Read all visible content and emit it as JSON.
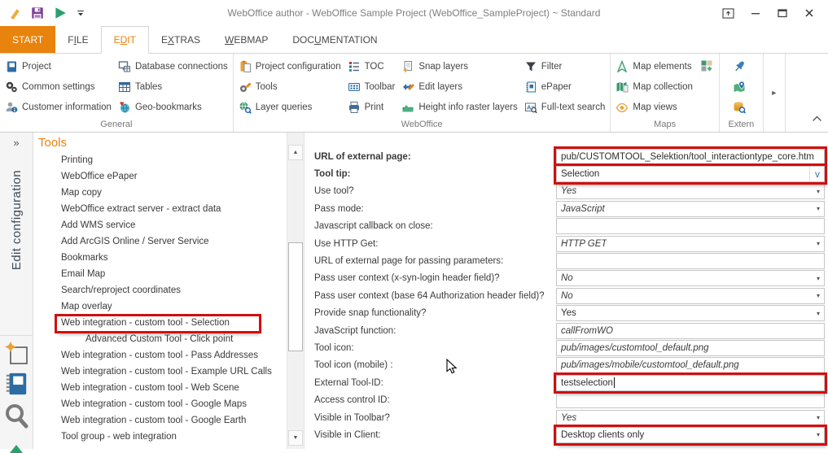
{
  "title_bar": {
    "title": "WebOffice author - WebOffice Sample Project (WebOffice_SampleProject) ~ Standard"
  },
  "glyphs": {
    "panel_collapse": "»",
    "scroll_up": "▲",
    "scroll_down": "▼",
    "dropdown_arrow": "▾",
    "combo_v": "v",
    "more_arrow": "►"
  },
  "ribbon": {
    "tabs": [
      {
        "pre": "START",
        "accel": "",
        "post": "",
        "is_start": true
      },
      {
        "pre": "F",
        "accel": "I",
        "post": "LE"
      },
      {
        "pre": "E",
        "accel": "D",
        "post": "IT",
        "is_active": true
      },
      {
        "pre": "E",
        "accel": "X",
        "post": "TRAS"
      },
      {
        "pre": "",
        "accel": "W",
        "post": "EBMAP"
      },
      {
        "pre": "DOC",
        "accel": "U",
        "post": "MENTATION"
      }
    ],
    "groups": {
      "general": {
        "label": "General",
        "buttons": [
          {
            "label": "Project",
            "icon": "project-icon"
          },
          {
            "label": "Common settings",
            "icon": "common-settings-icon"
          },
          {
            "label": "Customer information",
            "icon": "customer-information-icon"
          },
          {
            "label": "Database connections",
            "icon": "database-connections-icon"
          },
          {
            "label": "Tables",
            "icon": "tables-icon"
          },
          {
            "label": "Geo-bookmarks",
            "icon": "geo-bookmarks-icon"
          }
        ]
      },
      "weboffice": {
        "label": "WebOffice",
        "buttons": [
          {
            "label": "Project configuration",
            "icon": "project-configuration-icon"
          },
          {
            "label": "Tools",
            "icon": "tools-icon"
          },
          {
            "label": "Layer queries",
            "icon": "layer-queries-icon"
          },
          {
            "label": "TOC",
            "icon": "toc-icon"
          },
          {
            "label": "Toolbar",
            "icon": "toolbar-icon"
          },
          {
            "label": "Print",
            "icon": "print-icon"
          },
          {
            "label": "Snap layers",
            "icon": "snap-layers-icon"
          },
          {
            "label": "Edit layers",
            "icon": "edit-layers-icon"
          },
          {
            "label": "Height info raster layers",
            "icon": "height-info-raster-layers-icon"
          },
          {
            "label": "Filter",
            "icon": "filter-icon"
          },
          {
            "label": "ePaper",
            "icon": "epaper-icon"
          },
          {
            "label": "Full-text search",
            "icon": "full-text-search-icon"
          }
        ]
      },
      "maps": {
        "label": "Maps",
        "buttons": [
          {
            "label": "Map elements",
            "icon": "map-elements-icon"
          },
          {
            "label": "Map collection",
            "icon": "map-collection-icon"
          },
          {
            "label": "Map views",
            "icon": "map-views-icon"
          }
        ]
      },
      "extern": {
        "label": "Extern",
        "buttons": [
          {
            "label": "",
            "icon": "extern-pin-icon"
          },
          {
            "label": "",
            "icon": "extern-map-pin-icon"
          },
          {
            "label": "",
            "icon": "extern-db-search-icon"
          }
        ]
      }
    }
  },
  "sidebar": {
    "panel_title": "Edit configuration"
  },
  "tree": {
    "header": "Tools",
    "items": [
      {
        "label": "Printing"
      },
      {
        "label": "WebOffice ePaper"
      },
      {
        "label": "Map copy"
      },
      {
        "label": "WebOffice extract server - extract data"
      },
      {
        "label": "Add WMS service"
      },
      {
        "label": "Add ArcGIS Online / Server Service"
      },
      {
        "label": "Bookmarks"
      },
      {
        "label": "Email Map"
      },
      {
        "label": "Search/reproject coordinates"
      },
      {
        "label": "Map overlay"
      },
      {
        "label": "Web integration - custom tool - Selection",
        "highlight": true
      },
      {
        "label": "Advanced Custom Tool - Click point",
        "indent2": true
      },
      {
        "label": "Web integration - custom tool - Pass Addresses"
      },
      {
        "label": "Web integration - custom tool - Example URL Calls"
      },
      {
        "label": "Web integration - custom tool - Web Scene"
      },
      {
        "label": "Web integration - custom tool - Google Maps"
      },
      {
        "label": "Web integration - custom tool - Google Earth"
      },
      {
        "label": "Tool group - web integration"
      }
    ]
  },
  "form": {
    "rows": [
      {
        "label": "URL of external page:",
        "value": "pub/CUSTOMTOOL_Selektion/tool_interactiontype_core.htm",
        "bold": true,
        "highlight": true
      },
      {
        "label": "Tool tip:",
        "value": "Selection",
        "bold": true,
        "is_combo": true,
        "highlight": true
      },
      {
        "label": "Use tool?",
        "value": "Yes",
        "italic": true,
        "is_dropdown": true
      },
      {
        "label": "Pass mode:",
        "value": "JavaScript",
        "italic": true,
        "is_dropdown": true
      },
      {
        "label": "Javascript callback on close:",
        "value": ""
      },
      {
        "label": "Use HTTP Get:",
        "value": "HTTP GET",
        "italic": true,
        "is_dropdown": true
      },
      {
        "label": "URL of external page for passing parameters:",
        "value": ""
      },
      {
        "label": "Pass user context (x-syn-login header field)?",
        "value": "No",
        "italic": true,
        "is_dropdown": true
      },
      {
        "label": "Pass user context (base 64 Authorization header field)?",
        "value": "No",
        "italic": true,
        "is_dropdown": true
      },
      {
        "label": "Provide snap functionality?",
        "value": "Yes",
        "is_dropdown": true
      },
      {
        "label": "JavaScript function:",
        "value": "callFromWO",
        "italic": true
      },
      {
        "label": "Tool icon:",
        "value": "pub/images/customtool_default.png",
        "italic": true
      },
      {
        "label": "Tool icon (mobile) :",
        "value": "pub/images/mobile/customtool_default.png",
        "italic": true
      },
      {
        "label": "External Tool-ID:",
        "value": "testselection",
        "caret": true,
        "highlight": true
      },
      {
        "label": "Access control ID:",
        "value": ""
      },
      {
        "label": "Visible in Toolbar?",
        "value": "Yes",
        "italic": true,
        "is_dropdown": true
      },
      {
        "label": "Visible in Client:",
        "value": "Desktop clients only",
        "is_dropdown": true,
        "highlight": true
      }
    ]
  },
  "colors": {
    "accent_orange": "#e8830d",
    "highlight_red": "#d10f0f",
    "title_gray": "#7e7e7e"
  }
}
